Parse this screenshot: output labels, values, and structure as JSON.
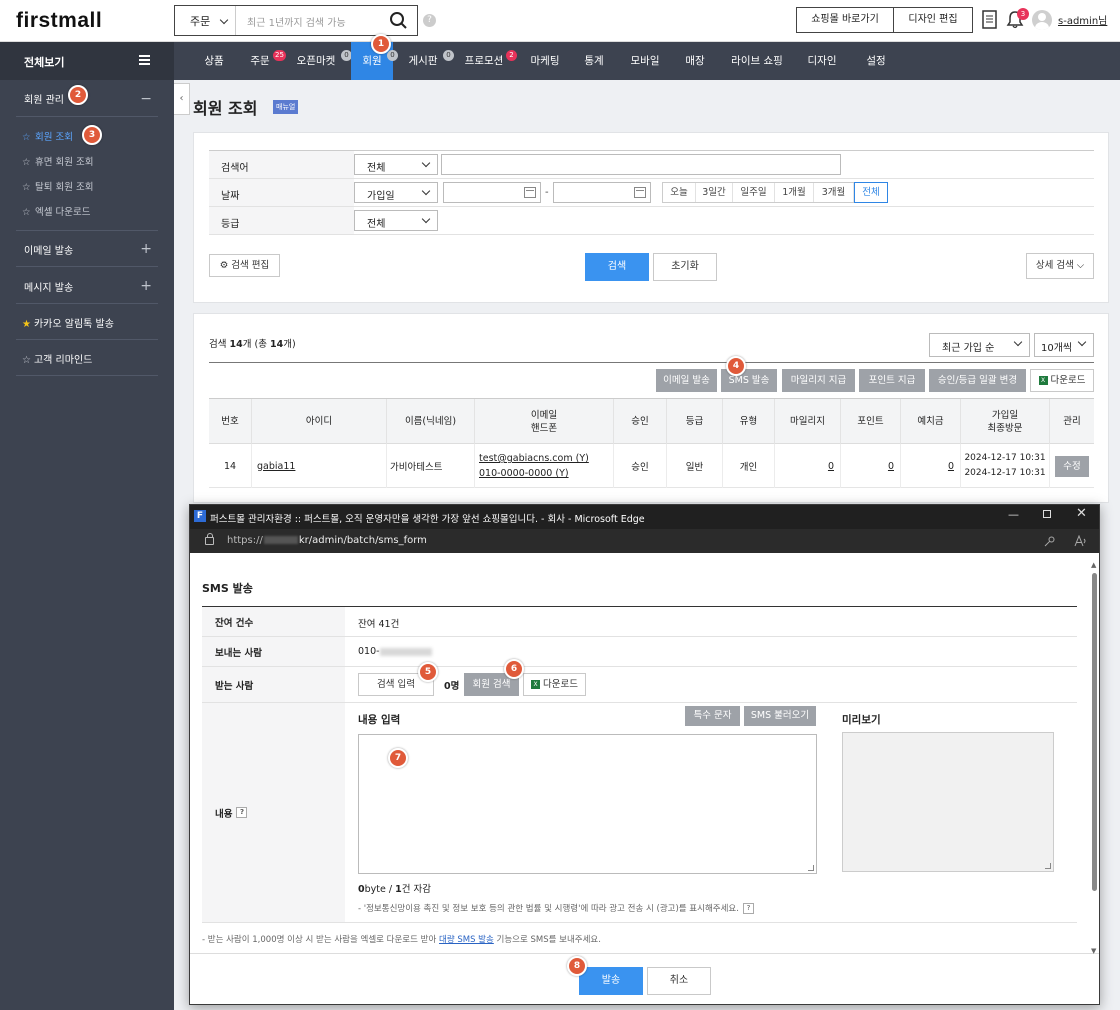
{
  "header": {
    "logo": "firstmall",
    "search_scope": "주문",
    "search_placeholder": "최근 1년까지 검색 가능",
    "help": "?",
    "shop_button": "쇼핑몰 바로가기",
    "design_button": "디자인 편집",
    "notification_count": "3",
    "username": "s-admin",
    "username_suffix": "님"
  },
  "sidebar": {
    "all_label": "전체보기",
    "member_section": "회원 관리",
    "member_items": [
      "회원 조회",
      "휴면 회원 조회",
      "탈퇴 회원 조회",
      "엑셀 다운로드"
    ],
    "email_section": "이메일 발송",
    "message_section": "메시지 발송",
    "kakao_section": "카카오 알림톡 발송",
    "remind_section": "고객 리마인드",
    "toggle": "‹",
    "plus": "+",
    "minus": "−"
  },
  "gnb": {
    "items": [
      "상품",
      "주문",
      "오픈마켓",
      "회원",
      "게시판",
      "프로모션",
      "마케팅",
      "통계",
      "모바일",
      "매장",
      "라이브 쇼핑",
      "디자인",
      "설정"
    ],
    "badges": {
      "order": "25",
      "openmarket": "0",
      "member": "0",
      "board": "0",
      "promotion": "2"
    },
    "active": "회원"
  },
  "page": {
    "title": "회원 조회",
    "manual": "매뉴얼"
  },
  "search_form": {
    "keyword_label": "검색어",
    "keyword_select": "전체",
    "date_label": "날짜",
    "date_select": "가입일",
    "date_dash": "-",
    "ranges": [
      "오늘",
      "3일간",
      "일주일",
      "1개월",
      "3개월",
      "전체"
    ],
    "grade_label": "등급",
    "grade_select": "전체",
    "edit_button": "검색 편집",
    "search_button": "검색",
    "reset_button": "초기화",
    "detail_button": "상세 검색"
  },
  "results": {
    "summary_prefix": "검색",
    "summary_count": "14",
    "summary_mid": "개 (총",
    "summary_total": "14",
    "summary_end": "개)",
    "sort_select": "최근 가입 순",
    "page_size_select": "10개씩",
    "action_buttons": [
      "이메일 발송",
      "SMS 발송",
      "마일리지 지급",
      "포인트 지급",
      "승인/등급 일괄 변경"
    ],
    "download_button": "다운로드",
    "columns": [
      "번호",
      "아이디",
      "이름(닉네임)",
      "이메일\n핸드폰",
      "승인",
      "등급",
      "유형",
      "마일리지",
      "포인트",
      "예치금",
      "가입일\n최종방문",
      "관리"
    ],
    "rows": [
      {
        "no": "14",
        "id": "gabia11",
        "name": "가비아테스트",
        "email": "test@gabiacns.com (Y)",
        "phone": "010-0000-0000 (Y)",
        "approval": "승인",
        "grade": "일반",
        "type": "개인",
        "mileage": "0",
        "point": "0",
        "deposit": "0",
        "joined": "2024-12-17 10:31",
        "last_visit": "2024-12-17 10:31",
        "action": "수정"
      }
    ]
  },
  "popup": {
    "window_title": "퍼스트몰 관리자환경 :: 퍼스트몰, 오직 운영자만을 생각한 가장 앞선 쇼핑몰입니다. - 회사 - Microsoft Edge",
    "favicon": "F",
    "url_prefix": "https://",
    "url_suffix": "kr/admin/batch/sms_form",
    "sms_title": "SMS 발송",
    "remaining_label": "잔여 건수",
    "remaining_value": "잔여 41건",
    "sender_label": "보내는 사람",
    "sender_value": "010-",
    "receiver_label": "받는 사람",
    "receiver_input_button": "검색 입력",
    "receiver_count": "0명",
    "member_search_button": "회원 검색",
    "receiver_download_button": "다운로드",
    "content_label": "내용",
    "content_input_title": "내용 입력",
    "special_char_button": "특수 문자",
    "sms_load_button": "SMS 불러오기",
    "preview_title": "미리보기",
    "byte_value": "0",
    "byte_label": "byte /",
    "count_value": "1",
    "count_label": "건 자감",
    "legal_note": "- '정보통신망이용 촉진 및 정보 보호 등의 관한 법률 및 시행령'에 따라 광고 전송 시 (광고)를 표시해주세요.",
    "bulk_note_prefix": "- 받는 사람이 1,000명 이상 시 받는 사람을 엑셀로 다운로드 받아",
    "bulk_note_link": "대량 SMS 발송",
    "bulk_note_suffix": "기능으로 SMS를 보내주세요.",
    "send_button": "발송",
    "cancel_button": "취소"
  },
  "steps": [
    "1",
    "2",
    "3",
    "4",
    "5",
    "6",
    "7",
    "8"
  ],
  "colors": {
    "accent": "#2f86e5",
    "sidebar": "#3d4350",
    "step": "#e05a3a",
    "badge": "#e8335a"
  }
}
